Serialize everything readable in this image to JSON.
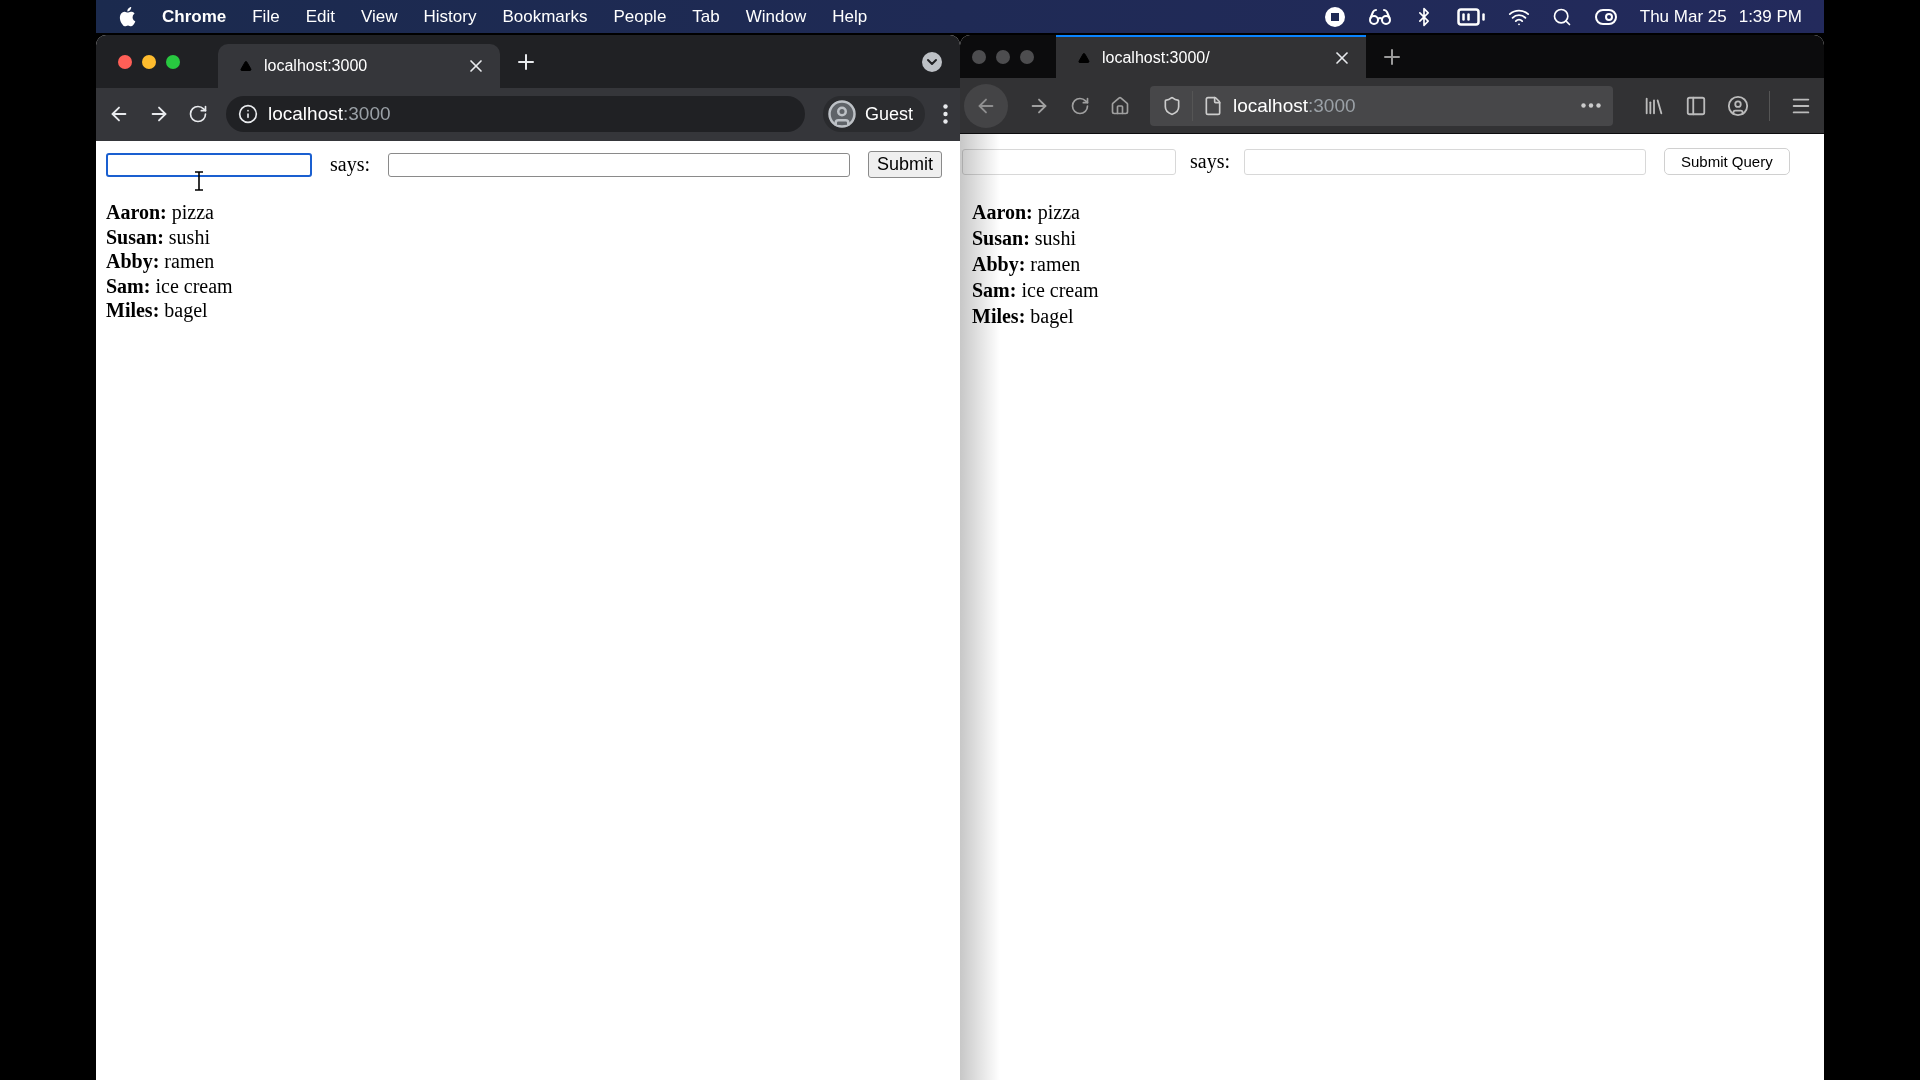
{
  "menu_bar": {
    "app_name": "Chrome",
    "items": [
      "File",
      "Edit",
      "View",
      "History",
      "Bookmarks",
      "People",
      "Tab",
      "Window",
      "Help"
    ],
    "date": "Thu Mar 25",
    "time": "1:39 PM"
  },
  "browsers": [
    {
      "kind": "chrome",
      "focused_window": true,
      "tab": {
        "title": "localhost:3000"
      },
      "address": {
        "host": "localhost",
        "port": ":3000"
      },
      "profile": "Guest",
      "page": {
        "name_field": {
          "focused": true
        },
        "says_label": "says:",
        "submit": "Submit",
        "entries": [
          "**Aaron:** pizza",
          "**Susan:** sushi",
          "**Abby:** ramen",
          "**Sam:** ice cream",
          "**Miles:** bagel"
        ]
      }
    },
    {
      "kind": "firefox",
      "focused_window": false,
      "tab": {
        "title": "localhost:3000/"
      },
      "address": {
        "host": "localhost",
        "port": ":3000"
      },
      "page": {
        "name_field": {
          "focused": false
        },
        "says_label": "says:",
        "submit": "Submit Query",
        "entries": [
          "**Aaron:** pizza",
          "**Susan:** sushi",
          "**Abby:** ramen",
          "**Sam:** ice cream",
          "**Miles:** bagel"
        ]
      }
    }
  ]
}
